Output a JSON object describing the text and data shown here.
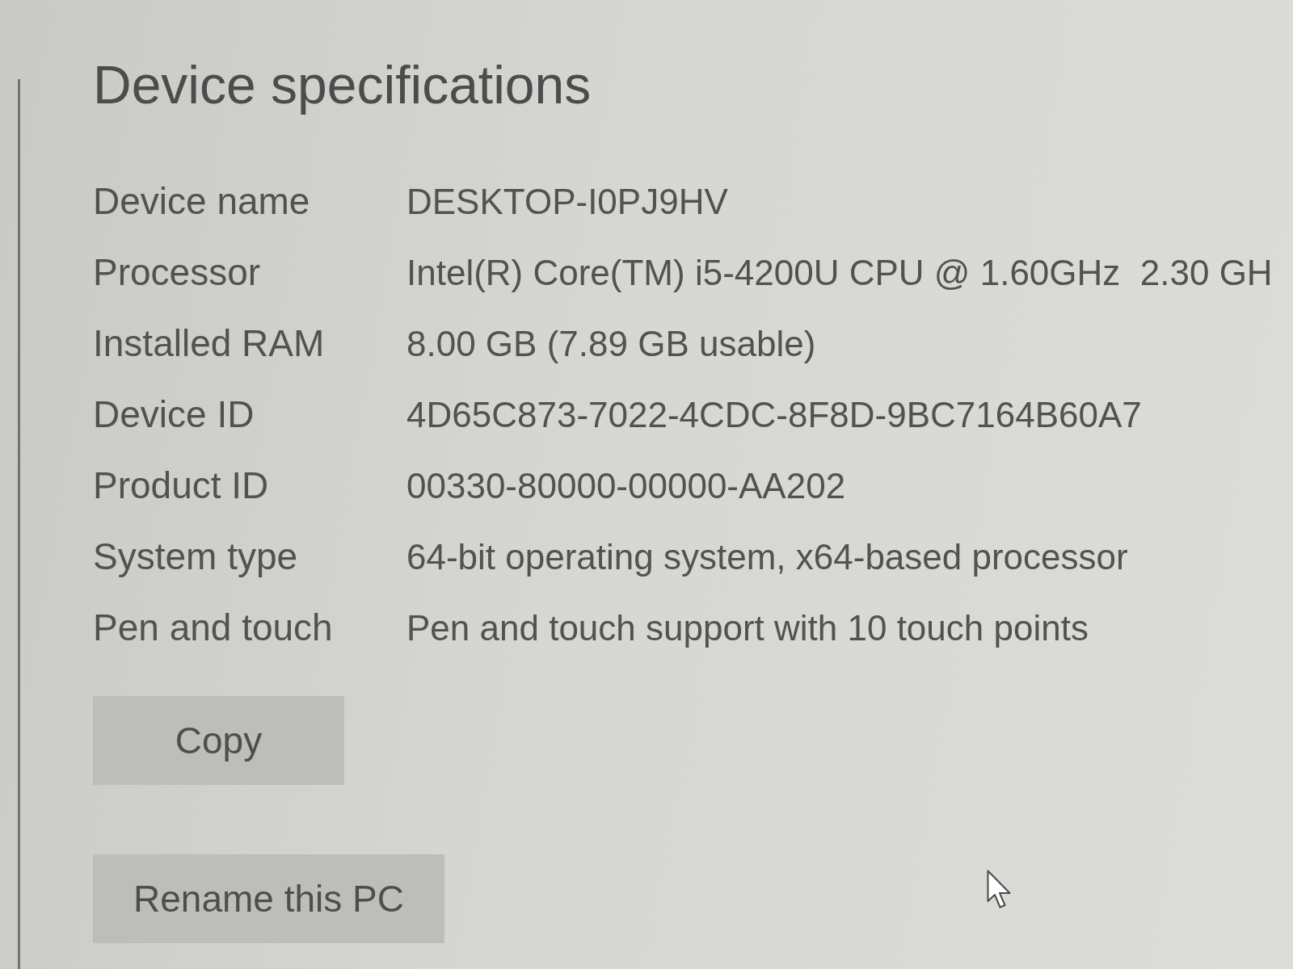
{
  "section": {
    "title": "Device specifications"
  },
  "specs": [
    {
      "label": "Device name",
      "value": "DESKTOP-I0PJ9HV"
    },
    {
      "label": "Processor",
      "value": "Intel(R) Core(TM) i5-4200U CPU @ 1.60GHz  2.30 GH"
    },
    {
      "label": "Installed RAM",
      "value": "8.00 GB (7.89 GB usable)"
    },
    {
      "label": "Device ID",
      "value": "4D65C873-7022-4CDC-8F8D-9BC7164B60A7"
    },
    {
      "label": "Product ID",
      "value": "00330-80000-00000-AA202"
    },
    {
      "label": "System type",
      "value": "64-bit operating system, x64-based processor"
    },
    {
      "label": "Pen and touch",
      "value": "Pen and touch support with 10 touch points"
    }
  ],
  "buttons": [
    {
      "label": "Copy"
    },
    {
      "label": "Rename this PC"
    }
  ]
}
